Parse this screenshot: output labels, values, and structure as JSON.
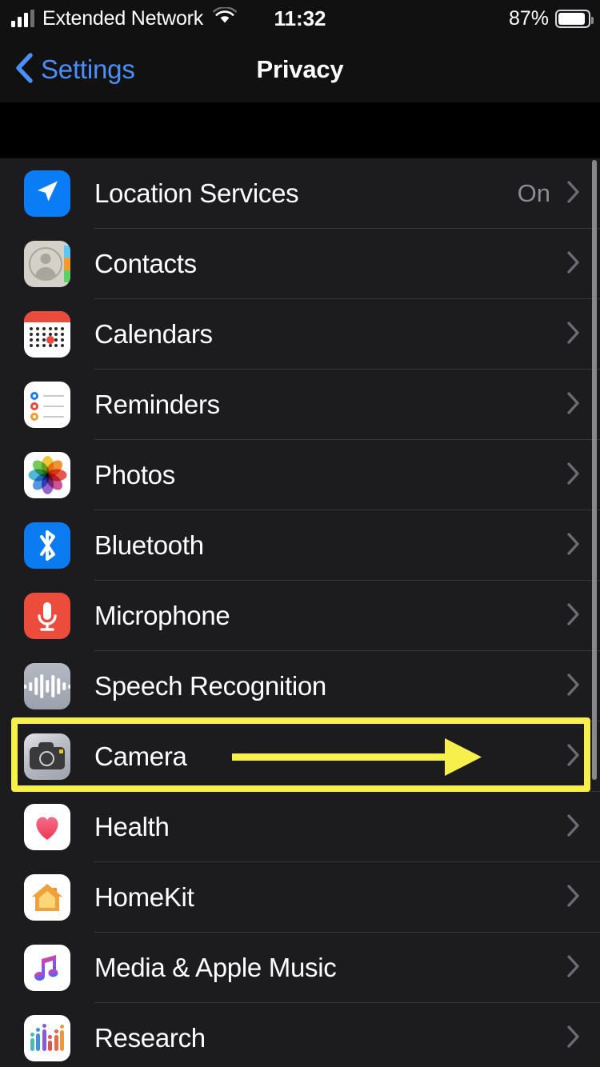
{
  "status_bar": {
    "carrier": "Extended Network",
    "time": "11:32",
    "battery_percent": "87%",
    "signal_icon": "cellular-bars-icon",
    "wifi_icon": "wifi-icon",
    "battery_icon": "battery-icon"
  },
  "nav": {
    "back_label": "Settings",
    "back_icon": "chevron-left-icon",
    "title": "Privacy"
  },
  "list": {
    "rows": [
      {
        "label": "Location Services",
        "value": "On",
        "icon": "location-services-icon"
      },
      {
        "label": "Contacts",
        "value": "",
        "icon": "contacts-icon"
      },
      {
        "label": "Calendars",
        "value": "",
        "icon": "calendars-icon"
      },
      {
        "label": "Reminders",
        "value": "",
        "icon": "reminders-icon"
      },
      {
        "label": "Photos",
        "value": "",
        "icon": "photos-icon"
      },
      {
        "label": "Bluetooth",
        "value": "",
        "icon": "bluetooth-icon"
      },
      {
        "label": "Microphone",
        "value": "",
        "icon": "microphone-icon"
      },
      {
        "label": "Speech Recognition",
        "value": "",
        "icon": "speech-recognition-icon"
      },
      {
        "label": "Camera",
        "value": "",
        "icon": "camera-icon"
      },
      {
        "label": "Health",
        "value": "",
        "icon": "health-icon"
      },
      {
        "label": "HomeKit",
        "value": "",
        "icon": "homekit-icon"
      },
      {
        "label": "Media & Apple Music",
        "value": "",
        "icon": "media-apple-music-icon"
      },
      {
        "label": "Research",
        "value": "",
        "icon": "research-icon"
      }
    ],
    "chevron_icon": "chevron-right-icon"
  },
  "annotation": {
    "highlight_target": "Camera",
    "highlight_color": "#F6EF4C",
    "arrow_icon": "pointer-arrow-right-icon"
  },
  "colors": {
    "accent_blue": "#4B8FFB",
    "row_background": "#1C1C1E",
    "screen_background": "#000000",
    "separator": "#38383A",
    "secondary_text": "#8B8B90",
    "annotation_yellow": "#F6EF4C"
  }
}
